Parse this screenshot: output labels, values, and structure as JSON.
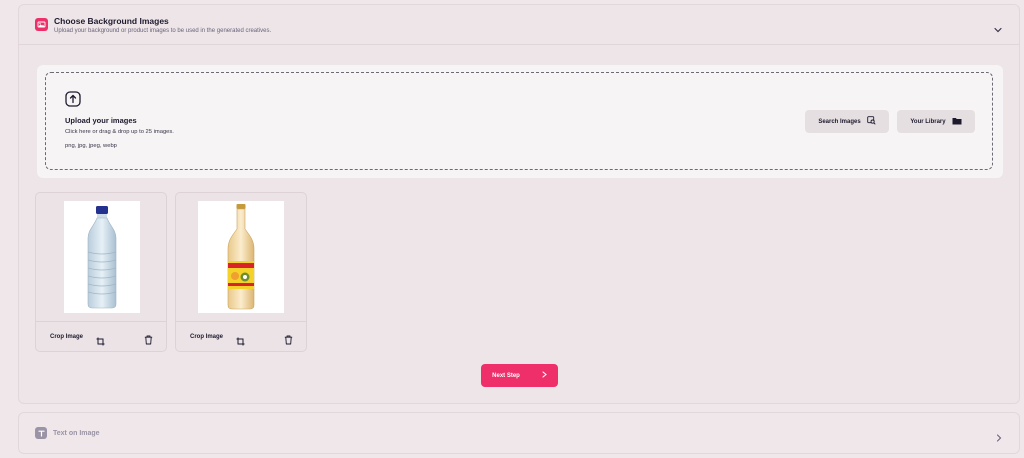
{
  "background_section": {
    "title": "Choose Background Images",
    "subtitle": "Upload your background or product images to be used in the generated creatives.",
    "icon": "image-icon",
    "expanded": true
  },
  "upload": {
    "title": "Upload your images",
    "hint": "Click here or drag & drop up to 25 images.",
    "formats": "png, jpg, jpeg, webp",
    "search_button": "Search Images",
    "library_button": "Your Library"
  },
  "images": [
    {
      "crop_label": "Crop Image",
      "content": "water-bottle"
    },
    {
      "crop_label": "Crop Image",
      "content": "juice-bottle"
    }
  ],
  "next_button": "Next Step",
  "text_section": {
    "title": "Text on Image",
    "icon": "text-icon",
    "expanded": false
  },
  "colors": {
    "accent": "#ee2f6a",
    "page_bg": "#efe7ea",
    "muted": "#9a93a4"
  }
}
